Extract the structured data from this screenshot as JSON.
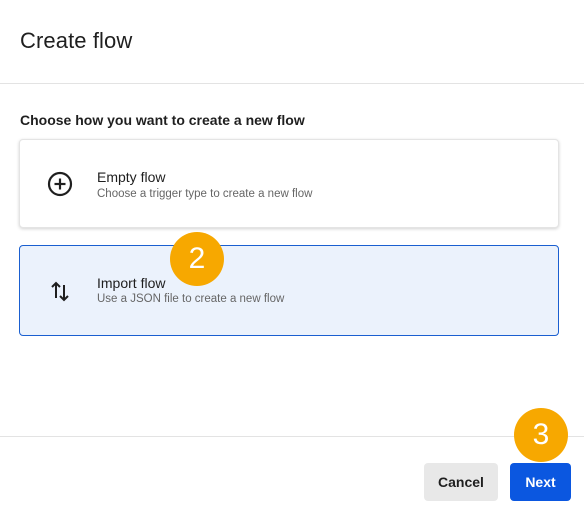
{
  "dialog": {
    "title": "Create flow",
    "prompt": "Choose how you want to create a new flow"
  },
  "options": [
    {
      "title": "Empty flow",
      "description": "Choose a trigger type to create a new flow",
      "icon": "plus-circle-icon",
      "selected": false
    },
    {
      "title": "Import flow",
      "description": "Use a JSON file to create a new flow",
      "icon": "swap-vertical-icon",
      "selected": true
    }
  ],
  "footer": {
    "cancel_label": "Cancel",
    "next_label": "Next"
  },
  "annotations": {
    "step_2": "2",
    "step_3": "3"
  },
  "colors": {
    "primary": "#0b57e0",
    "selected_border": "#1a5fd0",
    "selected_bg": "#ebf2fc",
    "badge": "#f7a800",
    "cancel_bg": "#e8e8e8"
  }
}
